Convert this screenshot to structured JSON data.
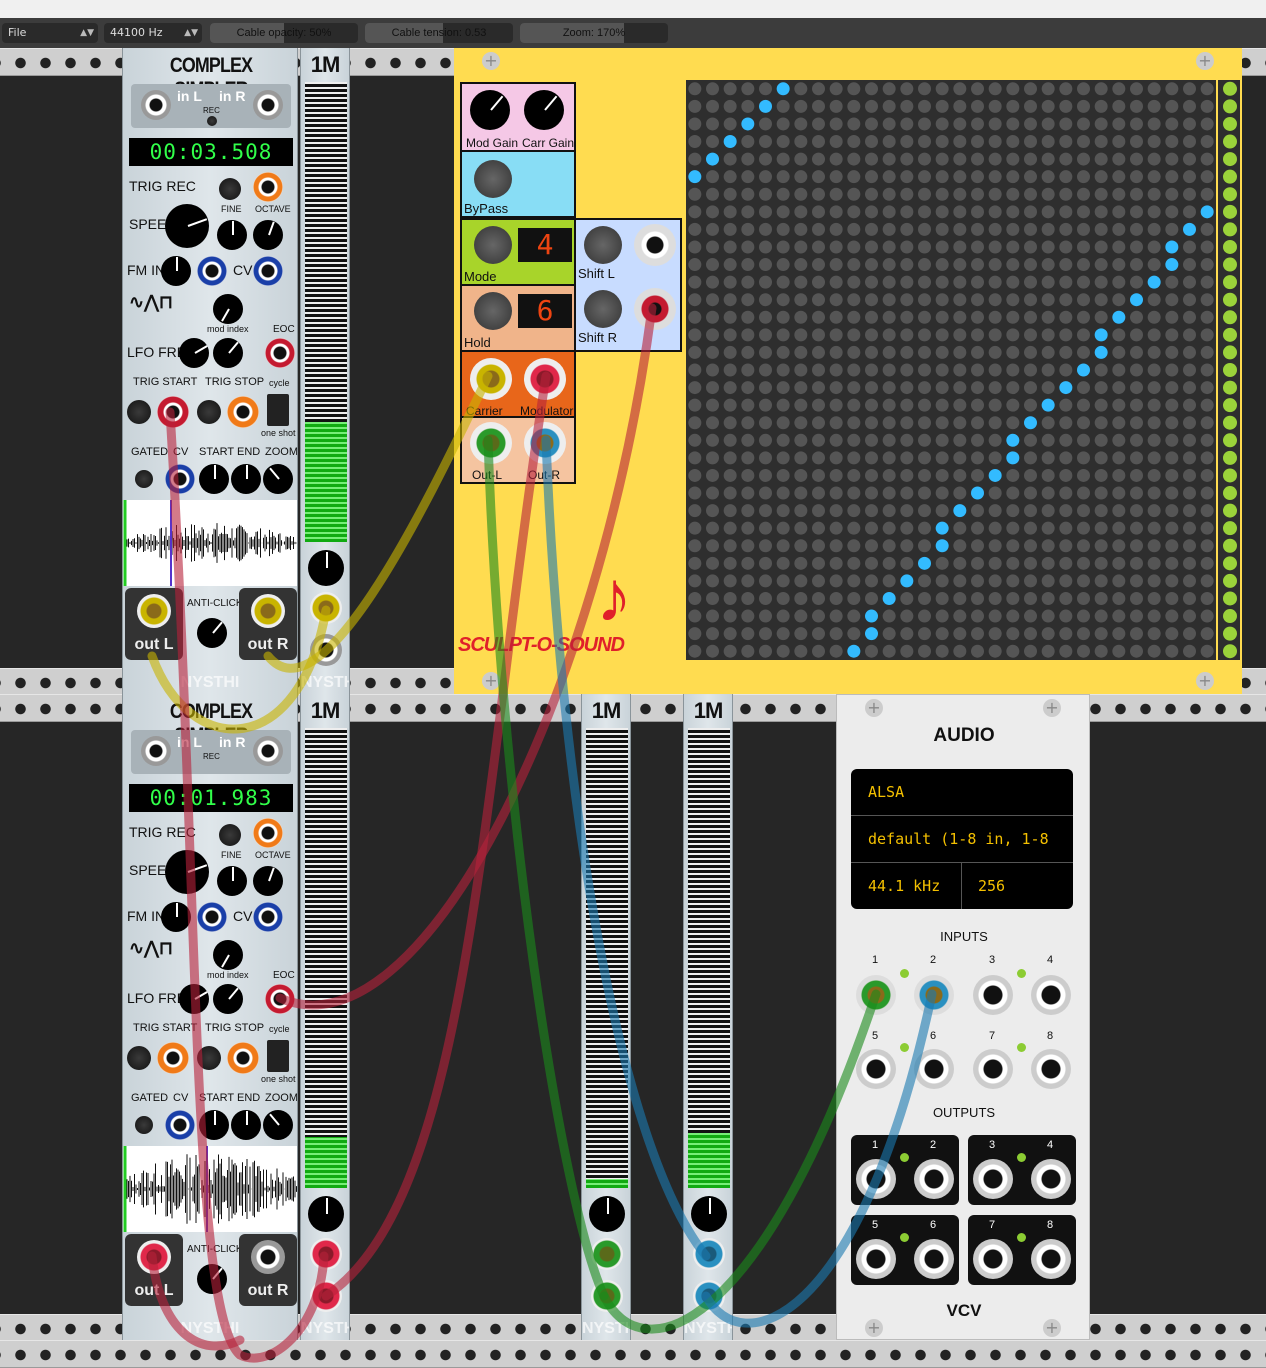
{
  "toolbar": {
    "file_label": "File",
    "sample_rate": "44100 Hz",
    "cable_opacity": "Cable opacity: 50%",
    "cable_opacity_value": 0.5,
    "cable_tension": "Cable tension: 0.53",
    "cable_tension_value": 0.53,
    "zoom": "Zoom: 170%",
    "zoom_value": 0.7
  },
  "simpler_top": {
    "title": "COMPLEX SIMPLER",
    "in_l": "in L",
    "in_r": "in R",
    "rec": "REC",
    "time": "00:03.508",
    "trig_rec": "TRIG REC",
    "speed": "SPEED",
    "fine": "FINE",
    "octave": "OCTAVE",
    "fm_in": "FM IN",
    "cv": "CV",
    "mod_index": "mod index",
    "eoc": "EOC",
    "lfo_freq": "LFO FREQ",
    "trig_start": "TRIG START",
    "trig_stop": "TRIG STOP",
    "cycle": "cycle",
    "one_shot": "one shot",
    "gated": "GATED",
    "cv2": "CV",
    "start": "START",
    "end": "END",
    "zoom": "ZOOM",
    "anti_click": "ANTI-CLICK",
    "out_l": "out L",
    "out_r": "out R",
    "brand": "NYSTHI"
  },
  "simpler_bottom": {
    "title": "COMPLEX SIMPLER",
    "in_l": "in L",
    "in_r": "in R",
    "rec": "REC",
    "time": "00:01.983",
    "trig_rec": "TRIG REC",
    "speed": "SPEED",
    "fine": "FINE",
    "octave": "OCTAVE",
    "fm_in": "FM IN",
    "cv": "CV",
    "mod_index": "mod index",
    "eoc": "EOC",
    "lfo_freq": "LFO FREQ",
    "trig_start": "TRIG START",
    "trig_stop": "TRIG STOP",
    "cycle": "cycle",
    "one_shot": "one shot",
    "gated": "GATED",
    "cv2": "CV",
    "start": "START",
    "end": "END",
    "zoom": "ZOOM",
    "anti_click": "ANTI-CLICK",
    "out_l": "out L",
    "out_r": "out R",
    "brand": "NYSTHI"
  },
  "meters": [
    {
      "title": "1M",
      "brand": "NYSTHI",
      "level": 0.26
    },
    {
      "title": "1M",
      "brand": "NYSTHI",
      "level": 0.11
    },
    {
      "title": "1M",
      "brand": "NYSTHI",
      "level": 0.02
    },
    {
      "title": "1M",
      "brand": "NYSTHI",
      "level": 0.12
    }
  ],
  "sculpt": {
    "mod_gain": "Mod Gain",
    "carr_gain": "Carr Gain",
    "bypass": "ByPass",
    "mode": "Mode",
    "mode_value": "4",
    "hold": "Hold",
    "hold_value": "6",
    "shift_l": "Shift L",
    "shift_r": "Shift R",
    "carrier": "Carrier",
    "modulator": "Modulator",
    "out_l": "Out-L",
    "out_r": "Out-R",
    "logo": "SCULPT-O-SOUND"
  },
  "audio": {
    "title": "AUDIO",
    "driver": "ALSA",
    "device": "default (1-8 in, 1-8",
    "rate": "44.1 kHz",
    "block": "256",
    "inputs_label": "INPUTS",
    "outputs_label": "OUTPUTS",
    "ports": [
      "1",
      "2",
      "3",
      "4",
      "5",
      "6",
      "7",
      "8"
    ],
    "brand": "VCV"
  },
  "colors": {
    "cable_yellow": "#c8b400",
    "cable_red": "#b8223a",
    "cable_green": "#1a8a1a",
    "cable_blue": "#1a7ab0",
    "grid_dot": "#555555",
    "grid_active": "#33bbff",
    "strip_led": "#9bd33a"
  }
}
